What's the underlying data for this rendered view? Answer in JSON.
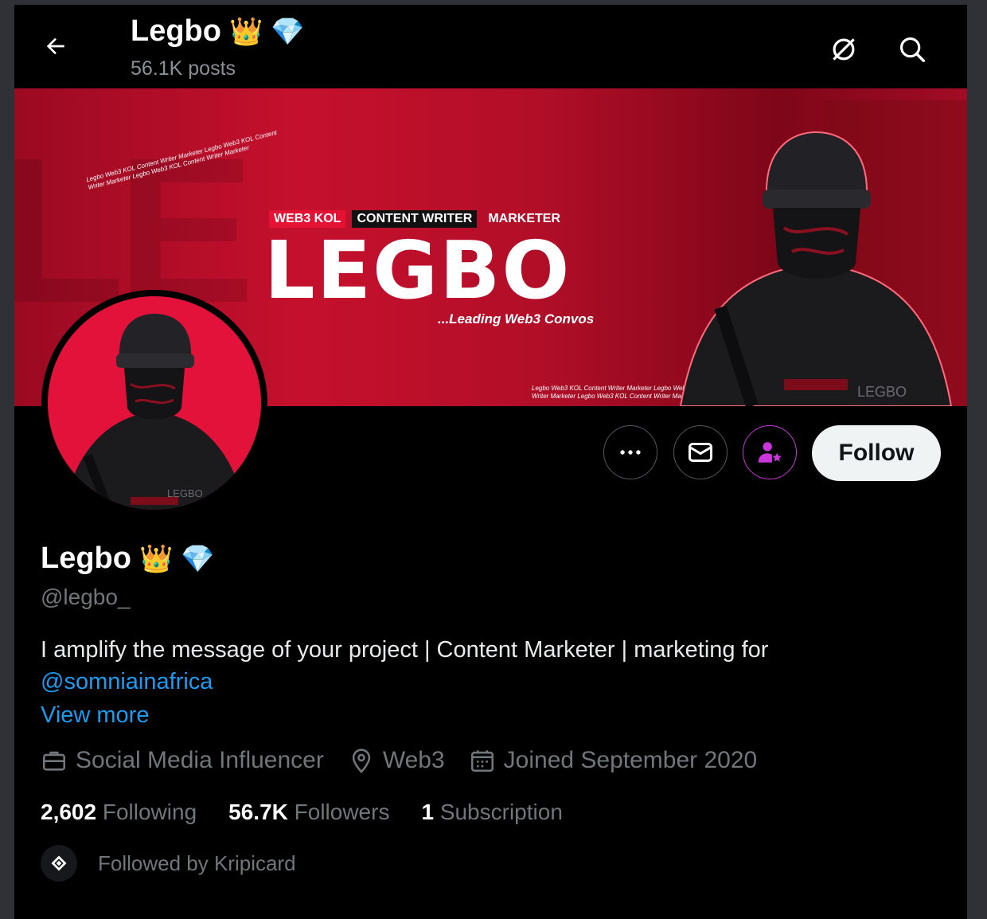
{
  "header": {
    "title": "Legbo",
    "posts_count": "56.1K posts",
    "name_emojis": [
      "👑",
      "💎"
    ]
  },
  "banner": {
    "tags": [
      "WEB3 KOL",
      "CONTENT WRITER",
      "MARKETER"
    ],
    "big_text": "LEGBO",
    "subtitle": "...Leading Web3 Convos",
    "repeat_text": "Legbo Web3 KOL Content Writer Marketer Legbo Web3 KOL Content Writer Marketer Legbo Web3 KOL Content Writer Marketer",
    "brand_mark": "LEGBO",
    "colors": {
      "primary": "#c5102d",
      "dark": "#7e0618"
    }
  },
  "avatar": {
    "brand_mark": "LEGBO",
    "bg_color": "#e3123b"
  },
  "actions": {
    "follow_label": "Follow"
  },
  "profile": {
    "display_name": "Legbo",
    "handle": "@legbo_",
    "bio_text": "I amplify the message of your project | Content Marketer | marketing for",
    "bio_mention": "@somniainafrica",
    "view_more": "View more",
    "category": "Social Media Influencer",
    "location": "Web3",
    "joined": "Joined September 2020"
  },
  "stats": {
    "following_count": "2,602",
    "following_label": "Following",
    "followers_count": "56.7K",
    "followers_label": "Followers",
    "subscription_count": "1",
    "subscription_label": "Subscription"
  },
  "followed_by": "Followed by Kripicard",
  "colors": {
    "link": "#1d9bf0",
    "muted": "#71767b",
    "subscribe_accent": "#c936d9"
  }
}
